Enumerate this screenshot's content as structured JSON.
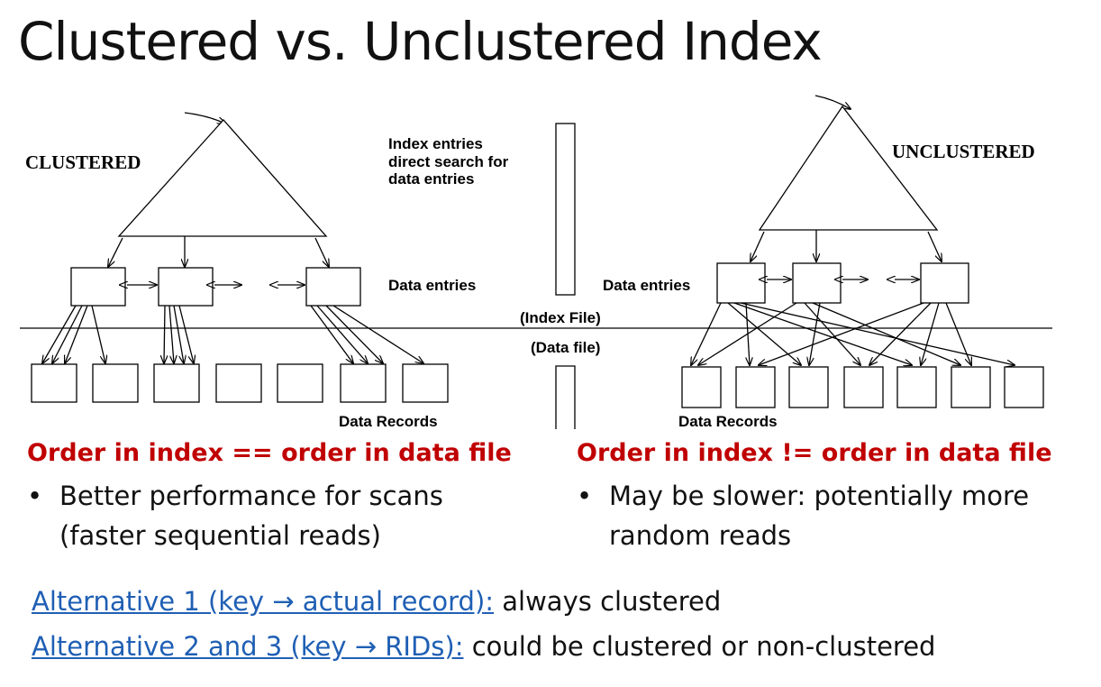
{
  "title": "Clustered vs. Unclustered Index",
  "diagram": {
    "clustered_label": "CLUSTERED",
    "unclustered_label": "UNCLUSTERED",
    "index_entries_lines": [
      "Index entries",
      "direct search for",
      "data entries"
    ],
    "data_entries_left": "Data entries",
    "data_entries_right": "Data entries",
    "index_file": "(Index File)",
    "data_file": "(Data file)",
    "data_records_left": "Data Records",
    "data_records_right": "Data Records"
  },
  "left": {
    "heading": "Order in index == order in data file",
    "bullet_lines": [
      "Better performance for scans",
      "(faster sequential reads)"
    ]
  },
  "right": {
    "heading": "Order in index != order in data file",
    "bullet_lines": [
      "May be slower: potentially more",
      "random reads"
    ]
  },
  "bullet_symbol": "•",
  "alternatives": [
    {
      "link": "Alternative 1 (key → actual record):",
      "text": " always clustered"
    },
    {
      "link": "Alternative 2 and 3 (key → RIDs):",
      "text": " could be clustered or non-clustered"
    }
  ],
  "colors": {
    "heading": "#c00000",
    "link": "#1f5fb4"
  }
}
